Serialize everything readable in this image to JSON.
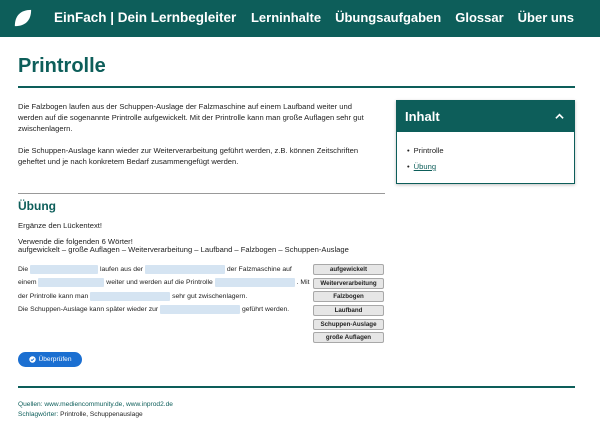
{
  "header": {
    "brand": "EinFach | Dein Lernbegleiter",
    "nav": [
      "Lerninhalte",
      "Übungsaufgaben",
      "Glossar",
      "Über uns"
    ],
    "logo_icon": "leaf-logo-icon"
  },
  "page": {
    "title": "Printrolle",
    "paragraph_1": "Die Falzbogen laufen aus der Schuppen-Auslage der Falzmaschine auf einem Laufband weiter und werden auf die sogenannte Printrolle aufgewickelt. Mit der Printrolle kann man große Auflagen sehr gut zwischenlagern.",
    "paragraph_2": "Die Schuppen-Auslage kann wieder zur Weiterverarbeitung geführt werden, z.B. können Zeitschriften geheftet und je nach konkretem Bedarf zusammengefügt werden."
  },
  "toc": {
    "title": "Inhalt",
    "items": [
      "Printrolle",
      "Übung"
    ],
    "chevron_icon": "chevron-up-icon"
  },
  "exercise": {
    "title": "Übung",
    "instruction": "Ergänze den Lückentext!",
    "words_intro": "Verwende die folgenden 6 Wörter!",
    "words_list": "aufgewickelt – große Auflagen – Weiterverarbeitung – Laufband – Falzbogen – Schuppen-Auslage",
    "cloze": {
      "s1": "Die",
      "s2": "laufen aus der",
      "s3": "der Falzmaschine auf einem",
      "s4": "weiter und werden auf die Printrolle",
      "s5": ". Mit der Printrolle kann man",
      "s6": "sehr gut zwischenlagern.",
      "s7": "Die Schuppen-Auslage kann später wieder zur",
      "s8": "geführt werden."
    },
    "chips": [
      "aufgewickelt",
      "Weiterverarbeitung",
      "Falzbogen",
      "Laufband",
      "Schuppen-Auslage",
      "große Auflagen"
    ],
    "check_label": "Überprüfen"
  },
  "footer": {
    "sources_label": "Quellen:",
    "sources": "www.mediencommunity.de, www.inprod2.de",
    "keywords_label": "Schlagwörter:",
    "keywords": "Printrolle, Schuppenauslage"
  },
  "colors": {
    "primary": "#0d5e5a",
    "button": "#1b6fd1",
    "gap_fill": "#d5e4f2",
    "chip_fill": "#e6e6e6"
  }
}
